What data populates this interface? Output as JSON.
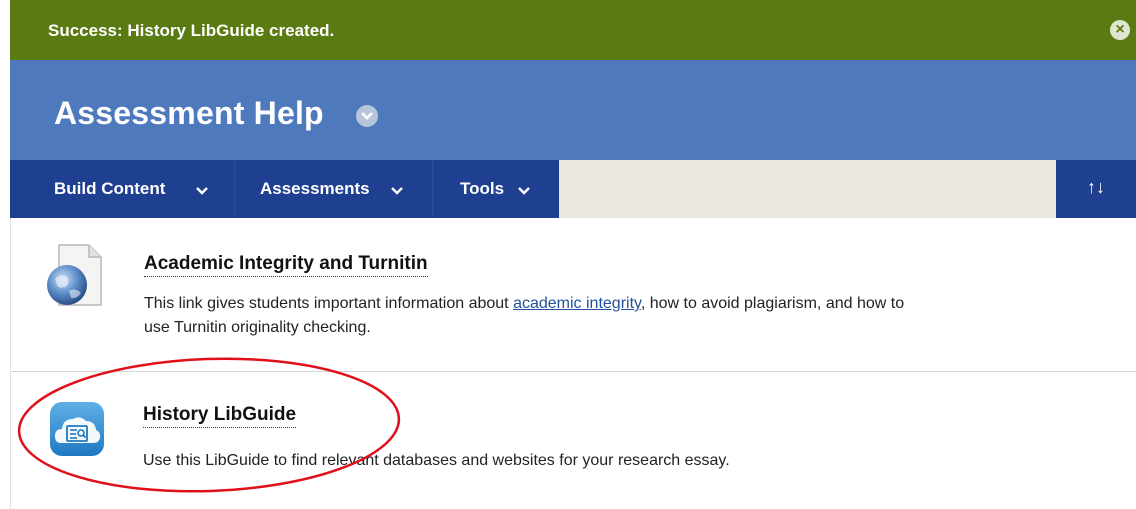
{
  "success": {
    "message": "Success: History LibGuide created.",
    "close_glyph": "×"
  },
  "page": {
    "title": "Assessment Help"
  },
  "action_bar": {
    "menus": [
      {
        "label": "Build Content"
      },
      {
        "label": "Assessments"
      },
      {
        "label": "Tools"
      }
    ],
    "reorder_glyph": "↑↓"
  },
  "items": [
    {
      "title": "Academic Integrity and Turnitin",
      "desc_before": "This link gives students important information about ",
      "desc_link": "academic integrity",
      "desc_line1_after": ", how to avoid plagiarism, and how to",
      "desc_line2": "use Turnitin originality checking.",
      "icon": "globe-document-icon"
    },
    {
      "title": "History LibGuide",
      "description": "Use this LibGuide to find relevant databases and websites for your research essay.",
      "icon": "libguide-cloud-icon"
    }
  ],
  "colors": {
    "success_bg": "#5a7a12",
    "header_bg": "#4e79bd",
    "menu_bg": "#1f3f90",
    "annotation": "#e0101a"
  }
}
